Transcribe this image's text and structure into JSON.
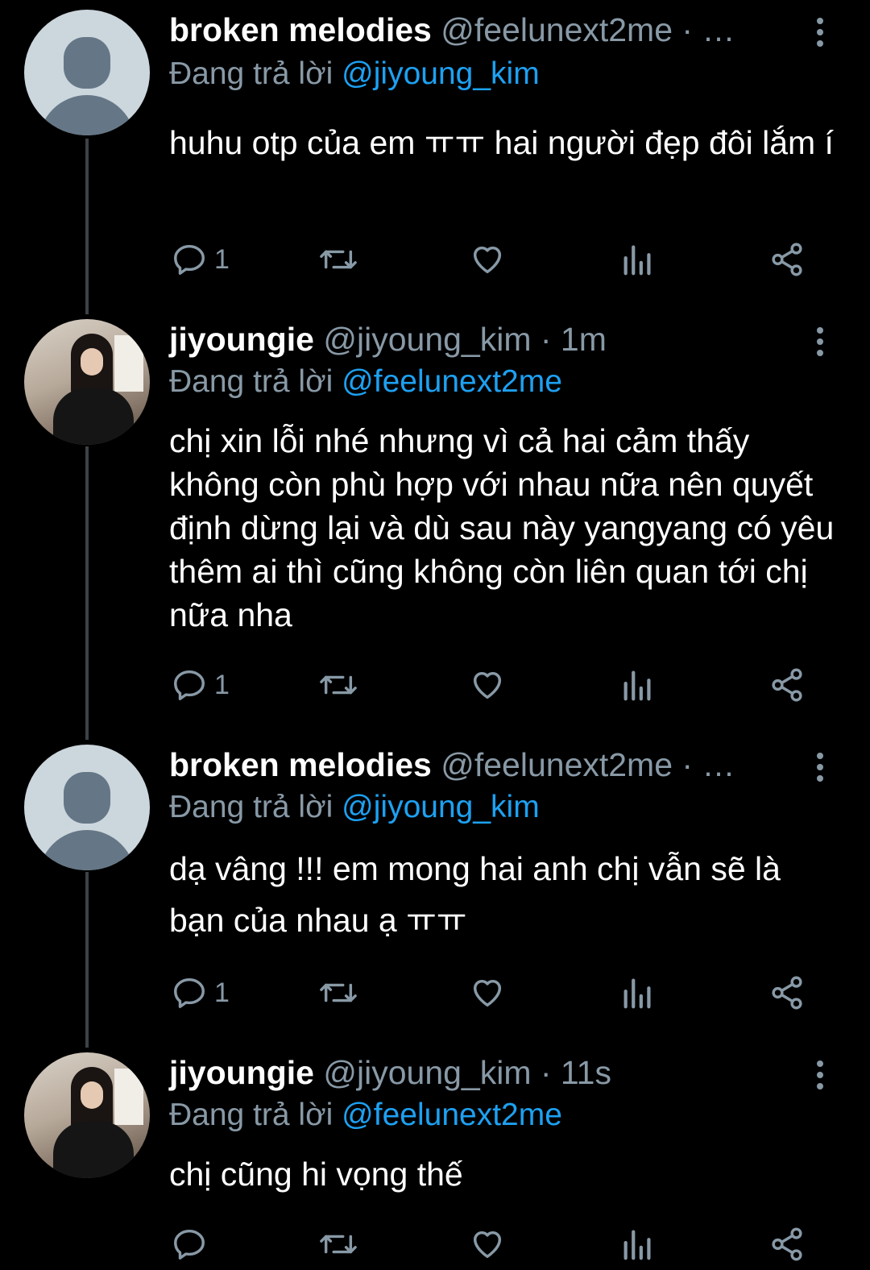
{
  "tweets": [
    {
      "name": "broken melodies",
      "handle": "@feelunext2me · …",
      "replying_prefix": "Đang trả lời",
      "mention": "@jiyoung_kim",
      "text": "huhu otp của em ㅠㅠ hai người đẹp đôi lắm í",
      "reply_count": "1",
      "avatar": "default-avatar"
    },
    {
      "name": "jiyoungie",
      "handle": "@jiyoung_kim · 1m",
      "replying_prefix": "Đang trả lời",
      "mention": "@feelunext2me",
      "text": "chị xin lỗi nhé nhưng vì cả hai cảm thấy không còn phù hợp với nhau nữa nên quyết định dừng lại và dù sau này yangyang có yêu thêm ai thì cũng không còn liên quan tới chị nữa nha",
      "reply_count": "1",
      "avatar": "photo-avatar"
    },
    {
      "name": "broken melodies",
      "handle": "@feelunext2me · …",
      "replying_prefix": "Đang trả lời",
      "mention": "@jiyoung_kim",
      "text": "dạ vâng !!! em mong hai anh chị vẫn sẽ là bạn của nhau ạ ㅠㅠ",
      "reply_count": "1",
      "avatar": "default-avatar"
    },
    {
      "name": "jiyoungie",
      "handle": "@jiyoung_kim · 11s",
      "replying_prefix": "Đang trả lời",
      "mention": "@feelunext2me",
      "text": "chị cũng hi vọng thế",
      "reply_count": "",
      "avatar": "photo-avatar"
    }
  ],
  "colors": {
    "background": "#000000",
    "text": "#ffffff",
    "secondary": "#8899a6",
    "mention": "#1da1f2",
    "thread_line": "#3d4247"
  },
  "icons": [
    "reply-icon",
    "retweet-icon",
    "like-icon",
    "analytics-icon",
    "share-icon",
    "more-icon"
  ]
}
